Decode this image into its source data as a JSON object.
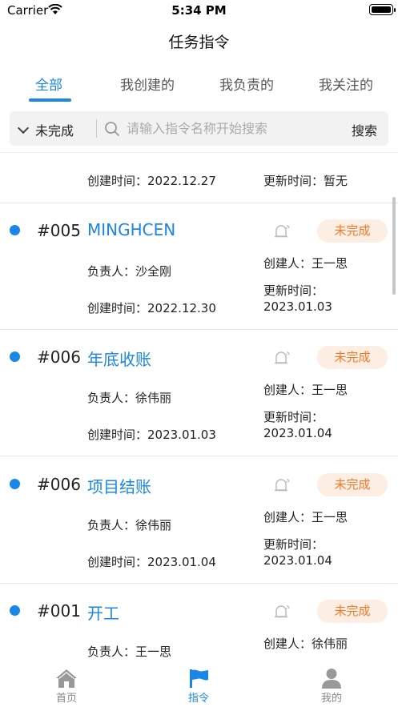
{
  "status_bar": {
    "carrier": "Carrier",
    "time": "5:34 PM"
  },
  "nav": {
    "title": "任务指令"
  },
  "tabs": [
    {
      "label": "全部",
      "active": true
    },
    {
      "label": "我创建的",
      "active": false
    },
    {
      "label": "我负责的",
      "active": false
    },
    {
      "label": "我关注的",
      "active": false
    }
  ],
  "search": {
    "filter_label": "未完成",
    "placeholder": "请输入指令名称开始搜索",
    "button_label": "搜索"
  },
  "partial_item": {
    "created": "创建时间：2022.12.27",
    "updated": "更新时间：暂无"
  },
  "items": [
    {
      "code": "#005",
      "title": "MINGHCEN",
      "status": "未完成",
      "owner": "负责人：沙全刚",
      "creator": "创建人：王一思",
      "created": "创建时间：2022.12.30",
      "updated_label": "更新时间：",
      "updated": "2023.01.03"
    },
    {
      "code": "#006",
      "title": "年底收账",
      "status": "未完成",
      "owner": "负责人：徐伟丽",
      "creator": "创建人：王一思",
      "created": "创建时间：2023.01.03",
      "updated_label": "更新时间：",
      "updated": "2023.01.04"
    },
    {
      "code": "#006",
      "title": "项目结账",
      "status": "未完成",
      "owner": "负责人：徐伟丽",
      "creator": "创建人：王一思",
      "created": "创建时间：2023.01.04",
      "updated_label": "更新时间：",
      "updated": "2023.01.04"
    },
    {
      "code": "#001",
      "title": "开工",
      "status": "未完成",
      "owner": "负责人：王一思",
      "creator": "创建人：徐伟丽",
      "created": "",
      "updated_label": "",
      "updated": ""
    }
  ],
  "tabbar": [
    {
      "label": "首页",
      "icon": "home-icon"
    },
    {
      "label": "指令",
      "icon": "flag-icon",
      "active": true
    },
    {
      "label": "我的",
      "icon": "user-icon"
    }
  ],
  "colors": {
    "accent": "#1a87e6",
    "badge_bg": "#fdeee4",
    "badge_text": "#f07a2a"
  }
}
